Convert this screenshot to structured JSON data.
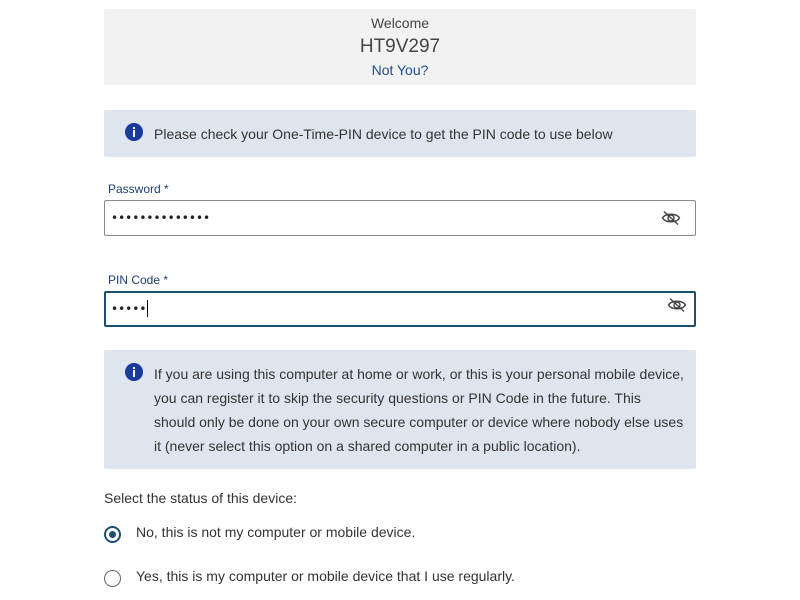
{
  "welcome": {
    "label": "Welcome",
    "username": "HT9V297",
    "not_you_link": "Not You?"
  },
  "otp_notice": {
    "icon": "info-icon",
    "text": "Please check your One-Time-PIN device to get the PIN code to use below"
  },
  "password": {
    "label": "Password *",
    "value": "••••••••••••••",
    "toggle_icon": "eye-slash-icon"
  },
  "pin": {
    "label": "PIN Code *",
    "value": "•••••",
    "toggle_icon": "eye-slash-icon"
  },
  "device_notice": {
    "icon": "info-icon",
    "text": "If you are using this computer at home or work, or this is your personal mobile device, you can register it to skip the security questions or PIN Code in the future. This should only be done on your own secure computer or device where nobody else uses it (never select this option on a shared computer in a public location)."
  },
  "device_status": {
    "label": "Select the status of this device:",
    "options": [
      {
        "label": "No, this is not my computer or mobile device.",
        "selected": true
      },
      {
        "label": "Yes, this is my computer or mobile device that I use regularly.",
        "selected": false
      }
    ]
  },
  "colors": {
    "accent": "#1d4f73",
    "info_bg": "#dfe5ef",
    "info_icon": "#1a3a9c",
    "link": "#1e4f8f",
    "welcome_bg": "#f2f2f2"
  }
}
